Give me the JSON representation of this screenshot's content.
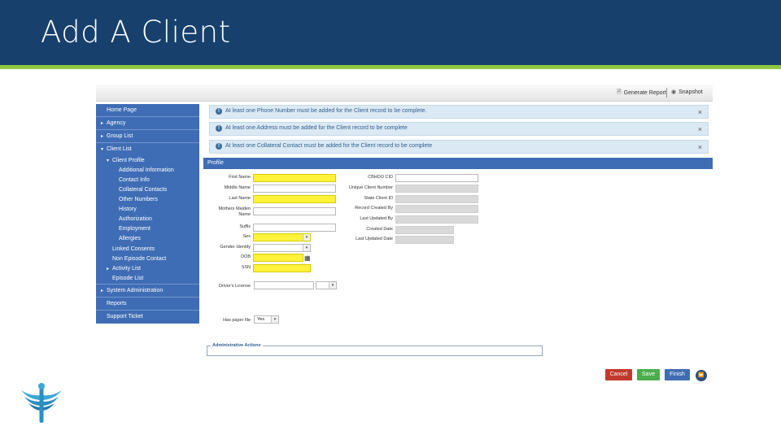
{
  "slide": {
    "title": "Add A Client"
  },
  "toolbar": {
    "generate_report": "Generate Report",
    "snapshot": "Snapshot"
  },
  "sidebar": {
    "home": "Home Page",
    "agency": "Agency",
    "group_list": "Group List",
    "client_list": "Client List",
    "client_profile": "Client Profile",
    "profile_items": [
      "Additional Information",
      "Contact Info",
      "Collateral Contacts",
      "Other Numbers",
      "History",
      "Authorization",
      "Employment",
      "Allergies"
    ],
    "linked_consents": "Linked Consents",
    "non_episode_contact": "Non Episode Contact",
    "activity_list": "Activity List",
    "episode_list": "Episode List",
    "system_administration": "System Administration",
    "reports": "Reports",
    "support_ticket": "Support Ticket"
  },
  "alerts": [
    "At least one Phone Number must be added for the Client record to be complete.",
    "At least one Address must be added for the Client record to be complete",
    "At least one Collateral Contact must be added for the Client record to be complete"
  ],
  "section": {
    "title": "Profile"
  },
  "form": {
    "labels": {
      "first_name": "First Name",
      "middle_name": "Middle Name",
      "last_name": "Last Name",
      "mothers_maiden_1": "Mothers Maiden",
      "mothers_maiden_2": "Name",
      "suffix": "Suffix",
      "sex": "Sex",
      "gender_identity": "Gender Identity",
      "dob": "DOB",
      "ssn": "SSN",
      "drivers_license": "Driver's License",
      "has_paper_file": "Has paper file",
      "cbhdo_cid": "CBHDO CID",
      "unique_client_number": "Unique Client Number",
      "state_client_id": "State Client ID",
      "record_created_by": "Record Created By",
      "last_updated_by": "Last Updated By",
      "created_date": "Created Date",
      "last_updated_date": "Last Updated Date"
    },
    "has_paper_file_value": "Yes"
  },
  "admin": {
    "title": "Administrative Actions"
  },
  "buttons": {
    "cancel": "Cancel",
    "save": "Save",
    "finish": "Finish"
  },
  "colors": {
    "header": "#17406d",
    "accent_rule": "#8dc63f",
    "sidebar": "#3f6db5",
    "required": "#fff23a"
  },
  "icons": [
    "generate-report-icon",
    "snapshot-icon",
    "info-icon",
    "close-icon",
    "calendar-icon",
    "chevron-down-icon",
    "fast-forward-icon",
    "logo-icon"
  ]
}
